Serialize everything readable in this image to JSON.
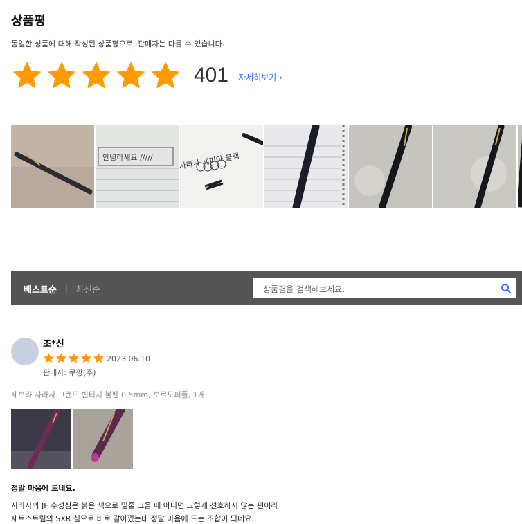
{
  "header": {
    "title": "상품평",
    "subtitle": "동일한 상품에 대해 작성된 상품평으로, 판매자는 다를 수 있습니다.",
    "rating_stars": 5,
    "review_count": "401",
    "more_link": "자세히보기 ›"
  },
  "photo_strip": {
    "handwriting_1": "안녕하세요 /////",
    "handwriting_2": "사라사 세피아 블랙"
  },
  "filter": {
    "tab_best": "베스트순",
    "separator": "|",
    "tab_recent": "최신순",
    "search_placeholder": "상품평을 검색해보세요."
  },
  "review": {
    "author": "조*신",
    "stars": 5,
    "date": "2023.06.10",
    "seller": "판매자: 쿠팡(주)",
    "option": "제브라 사라사 그랜드 빈티지 볼펜 0.5mm, 보르도퍼플, 1개",
    "headline": "정말 마음에 드네요.",
    "body_lines": [
      "사라사의 JF 수성심은 붉은 색으로 밑줄 그을 때 아니면 그렇게 선호하지 않는 편이라",
      "제트스트림의 SXR 심으로 바로 갈아꼈는데 정말 마음에 드는 조합이 되네요."
    ]
  },
  "colors": {
    "star": "#ff9a00",
    "link": "#346aff",
    "bar": "#555555"
  }
}
